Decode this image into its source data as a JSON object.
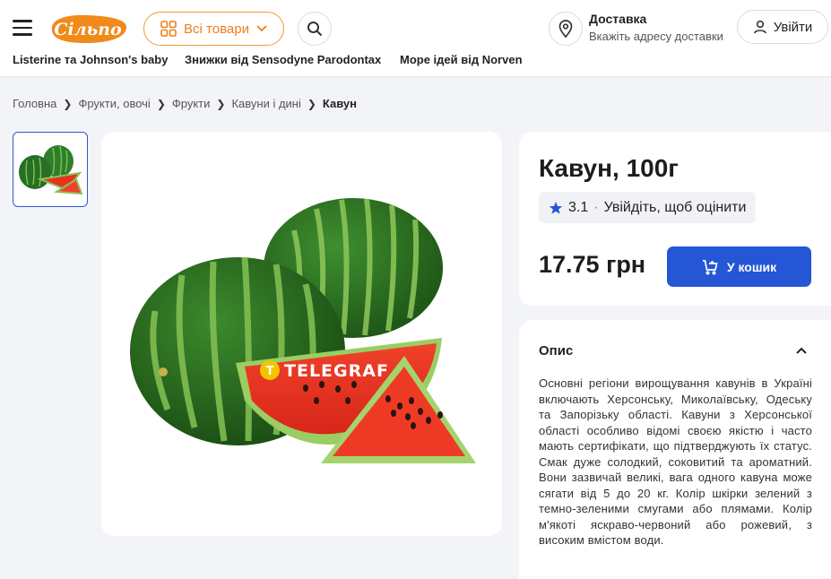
{
  "header": {
    "logo_text": "Сільпо",
    "all_goods_label": "Всі товари",
    "delivery_title": "Доставка",
    "delivery_subtitle": "Вкажіть адресу доставки",
    "login_label": "Увійти",
    "promos": [
      "Listerine та Johnson's baby",
      "Знижки від Sensodyne Parodontax",
      "Море ідей від Norven"
    ]
  },
  "breadcrumb": {
    "items": [
      "Головна",
      "Фрукти, овочі",
      "Фрукти",
      "Кавуни і дині"
    ],
    "current": "Кавун"
  },
  "product": {
    "title": "Кавун, 100г",
    "rating": "3.1",
    "rating_cta": "Увійдіть, щоб оцінити",
    "price": "17.75 грн",
    "cart_label": "У кошик",
    "watermark": "TELEGRAF"
  },
  "description": {
    "heading": "Опис",
    "text": "Основні регіони вирощування кавунів в Україні включають Херсонську, Миколаївську, Одеську та Запорізьку області. Кавуни з Херсонської області особливо відомі своєю якістю і часто мають сертифікати, що підтверджують їх статус. Смак дуже солодкий, соковитий та ароматний. Вони зазвичай великі, вага одного кавуна може сягати від 5 до 20 кг. Колір шкірки зелений з темно-зеленими смугами або плямами. Колір м'якоті яскраво-червоний або рожевий, з високим вмістом води."
  },
  "icons": {
    "menu": "hamburger-icon",
    "grid": "grid-icon",
    "chevron": "chevron-down-icon",
    "search": "search-icon",
    "location": "location-pin-icon",
    "user": "user-icon",
    "star": "star-icon",
    "cart": "cart-plus-icon",
    "collapse": "chevron-up-icon"
  },
  "colors": {
    "brand_orange": "#ef7f1a",
    "primary_blue": "#2456d6",
    "star_blue": "#2456d6"
  }
}
